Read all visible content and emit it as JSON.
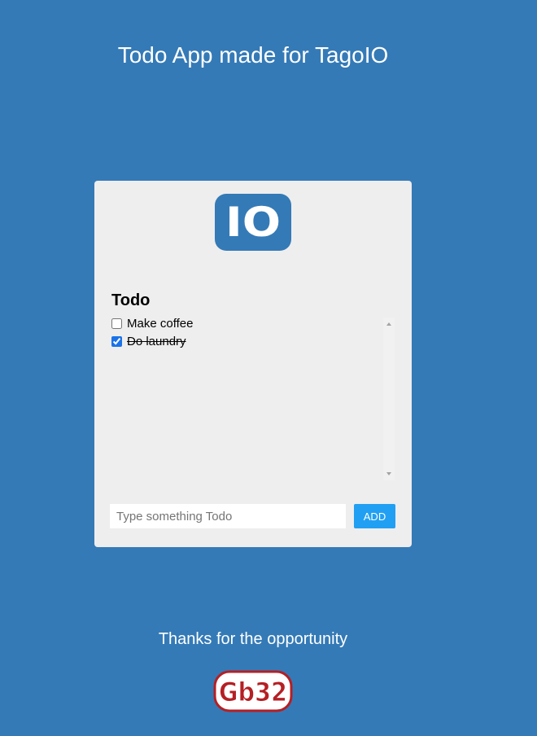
{
  "header": {
    "title": "Todo App made for TagoIO"
  },
  "card": {
    "logo_text": "IO",
    "section_title": "Todo",
    "todos": [
      {
        "label": "Make coffee",
        "done": false
      },
      {
        "label": "Do laundry",
        "done": true
      }
    ],
    "input": {
      "value": "",
      "placeholder": "Type something Todo"
    },
    "add_label": "ADD"
  },
  "footer": {
    "text": "Thanks for the opportunity",
    "logo_text": "Gb32"
  },
  "colors": {
    "background": "#347ab7",
    "card": "#eeeeee",
    "logo_blue": "#347ab7",
    "add_button": "#21a0f3",
    "footer_logo_red": "#b51f24"
  }
}
